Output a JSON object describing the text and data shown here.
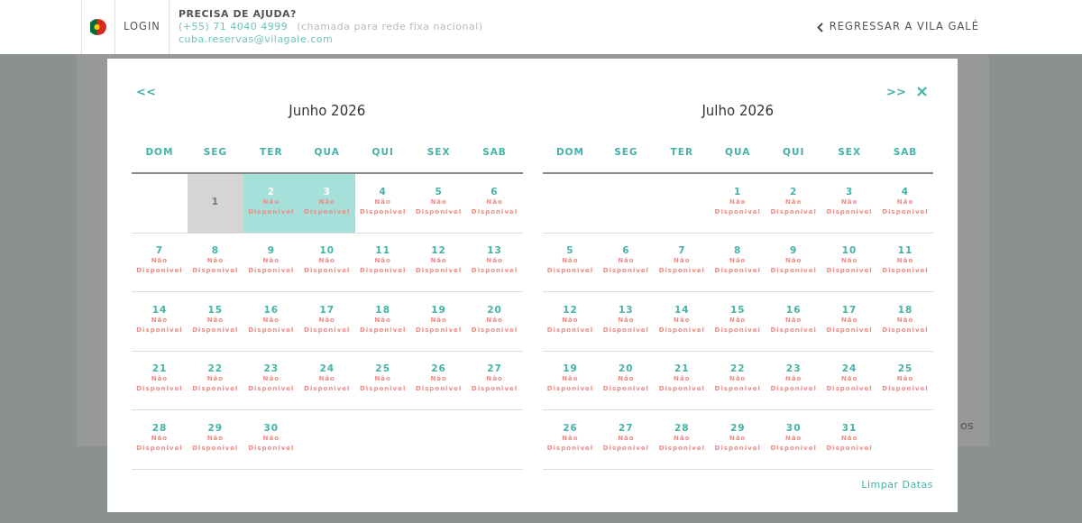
{
  "header": {
    "login": "LOGIN",
    "help_title": "PRECISA DE AJUDA?",
    "phone": "(+55) 71 4040 4999",
    "phone_note": "(chamada para rede fixa nacional)",
    "email": "cuba.reservas@vilagale.com",
    "back_link": "REGRESSAR A VILA GALÉ"
  },
  "background_text": "os",
  "datepicker": {
    "prev": "<<",
    "next": ">>",
    "close": "×",
    "clear": "Limpar Datas",
    "months": [
      {
        "title": "Junho 2026",
        "weekdays": [
          "DOM",
          "SEG",
          "TER",
          "QUA",
          "QUI",
          "SEX",
          "SAB"
        ],
        "weeks": [
          [
            {
              "day": "1",
              "disabled": true,
              "selected": false
            },
            {
              "day": "2",
              "status": "Não Disponivel",
              "disabled": false,
              "selected": true
            },
            {
              "day": "3",
              "status": "Não Disponivel",
              "disabled": false,
              "selected": true
            },
            {
              "day": "4",
              "status": "Não Disponivel",
              "disabled": false,
              "selected": false
            },
            {
              "day": "5",
              "status": "Não Disponivel",
              "disabled": false,
              "selected": false
            },
            {
              "day": "6",
              "status": "Não Disponivel",
              "disabled": false,
              "selected": false
            }
          ],
          [
            {
              "day": "7",
              "status": "Não Disponivel",
              "disabled": false,
              "selected": false
            },
            {
              "day": "8",
              "status": "Não Disponivel",
              "disabled": false,
              "selected": false
            },
            {
              "day": "9",
              "status": "Não Disponivel",
              "disabled": false,
              "selected": false
            },
            {
              "day": "10",
              "status": "Não Disponivel",
              "disabled": false,
              "selected": false
            },
            {
              "day": "11",
              "status": "Não Disponivel",
              "disabled": false,
              "selected": false
            },
            {
              "day": "12",
              "status": "Não Disponivel",
              "disabled": false,
              "selected": false
            },
            {
              "day": "13",
              "status": "Não Disponivel",
              "disabled": false,
              "selected": false
            }
          ],
          [
            {
              "day": "14",
              "status": "Não Disponivel",
              "disabled": false,
              "selected": false
            },
            {
              "day": "15",
              "status": "Não Disponivel",
              "disabled": false,
              "selected": false
            },
            {
              "day": "16",
              "status": "Não Disponivel",
              "disabled": false,
              "selected": false
            },
            {
              "day": "17",
              "status": "Não Disponivel",
              "disabled": false,
              "selected": false
            },
            {
              "day": "18",
              "status": "Não Disponivel",
              "disabled": false,
              "selected": false
            },
            {
              "day": "19",
              "status": "Não Disponivel",
              "disabled": false,
              "selected": false
            },
            {
              "day": "20",
              "status": "Não Disponivel",
              "disabled": false,
              "selected": false
            }
          ],
          [
            {
              "day": "21",
              "status": "Não Disponivel",
              "disabled": false,
              "selected": false
            },
            {
              "day": "22",
              "status": "Não Disponivel",
              "disabled": false,
              "selected": false
            },
            {
              "day": "23",
              "status": "Não Disponivel",
              "disabled": false,
              "selected": false
            },
            {
              "day": "24",
              "status": "Não Disponivel",
              "disabled": false,
              "selected": false
            },
            {
              "day": "25",
              "status": "Não Disponivel",
              "disabled": false,
              "selected": false
            },
            {
              "day": "26",
              "status": "Não Disponivel",
              "disabled": false,
              "selected": false
            },
            {
              "day": "27",
              "status": "Não Disponivel",
              "disabled": false,
              "selected": false
            }
          ],
          [
            {
              "day": "28",
              "status": "Não Disponivel",
              "disabled": false,
              "selected": false
            },
            {
              "day": "29",
              "status": "Não Disponivel",
              "disabled": false,
              "selected": false
            },
            {
              "day": "30",
              "status": "Não Disponivel",
              "disabled": false,
              "selected": false
            }
          ]
        ]
      },
      {
        "title": "Julho 2026",
        "weekdays": [
          "DOM",
          "SEG",
          "TER",
          "QUA",
          "QUI",
          "SEX",
          "SAB"
        ],
        "weeks": [
          [
            {
              "day": "1",
              "status": "Não Disponivel",
              "disabled": false,
              "selected": false
            },
            {
              "day": "2",
              "status": "Não Disponivel",
              "disabled": false,
              "selected": false
            },
            {
              "day": "3",
              "status": "Não Disponivel",
              "disabled": false,
              "selected": false
            },
            {
              "day": "4",
              "status": "Não Disponivel",
              "disabled": false,
              "selected": false
            }
          ],
          [
            {
              "day": "5",
              "status": "Não Disponivel",
              "disabled": false,
              "selected": false
            },
            {
              "day": "6",
              "status": "Não Disponivel",
              "disabled": false,
              "selected": false
            },
            {
              "day": "7",
              "status": "Não Disponivel",
              "disabled": false,
              "selected": false
            },
            {
              "day": "8",
              "status": "Não Disponivel",
              "disabled": false,
              "selected": false
            },
            {
              "day": "9",
              "status": "Não Disponivel",
              "disabled": false,
              "selected": false
            },
            {
              "day": "10",
              "status": "Não Disponivel",
              "disabled": false,
              "selected": false
            },
            {
              "day": "11",
              "status": "Não Disponivel",
              "disabled": false,
              "selected": false
            }
          ],
          [
            {
              "day": "12",
              "status": "Não Disponivel",
              "disabled": false,
              "selected": false
            },
            {
              "day": "13",
              "status": "Não Disponivel",
              "disabled": false,
              "selected": false
            },
            {
              "day": "14",
              "status": "Não Disponivel",
              "disabled": false,
              "selected": false
            },
            {
              "day": "15",
              "status": "Não Disponivel",
              "disabled": false,
              "selected": false
            },
            {
              "day": "16",
              "status": "Não Disponivel",
              "disabled": false,
              "selected": false
            },
            {
              "day": "17",
              "status": "Não Disponivel",
              "disabled": false,
              "selected": false
            },
            {
              "day": "18",
              "status": "Não Disponivel",
              "disabled": false,
              "selected": false
            }
          ],
          [
            {
              "day": "19",
              "status": "Não Disponivel",
              "disabled": false,
              "selected": false
            },
            {
              "day": "20",
              "status": "Não Disponivel",
              "disabled": false,
              "selected": false
            },
            {
              "day": "21",
              "status": "Não Disponivel",
              "disabled": false,
              "selected": false
            },
            {
              "day": "22",
              "status": "Não Disponivel",
              "disabled": false,
              "selected": false
            },
            {
              "day": "23",
              "status": "Não Disponivel",
              "disabled": false,
              "selected": false
            },
            {
              "day": "24",
              "status": "Não Disponivel",
              "disabled": false,
              "selected": false
            },
            {
              "day": "25",
              "status": "Não Disponivel",
              "disabled": false,
              "selected": false
            }
          ],
          [
            {
              "day": "26",
              "status": "Não Disponivel",
              "disabled": false,
              "selected": false
            },
            {
              "day": "27",
              "status": "Não Disponivel",
              "disabled": false,
              "selected": false
            },
            {
              "day": "28",
              "status": "Não Disponivel",
              "disabled": false,
              "selected": false
            },
            {
              "day": "29",
              "status": "Não Disponivel",
              "disabled": false,
              "selected": false
            },
            {
              "day": "30",
              "status": "Não Disponivel",
              "disabled": false,
              "selected": false
            },
            {
              "day": "31",
              "status": "Não Disponivel",
              "disabled": false,
              "selected": false
            }
          ]
        ]
      }
    ]
  }
}
